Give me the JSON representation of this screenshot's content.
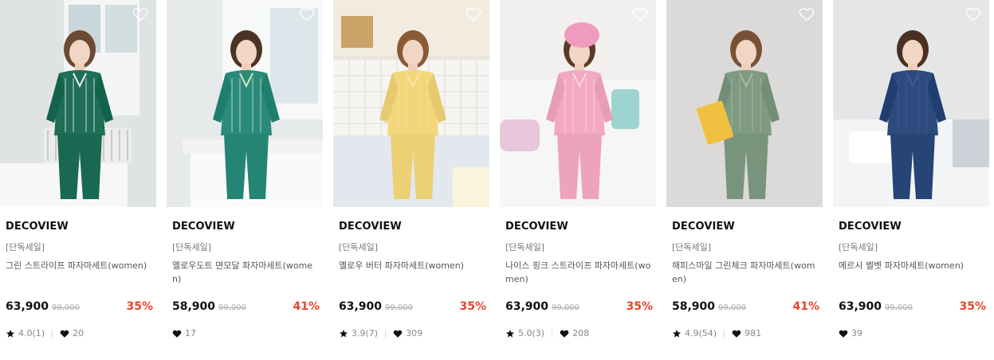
{
  "colors": {
    "discount": "#e8452c",
    "text": "#111111",
    "muted": "#888888"
  },
  "products": [
    {
      "brand": "DECOVIEW",
      "tag": "[단독세일]",
      "name": "그린 스트라이프 파자마세트(women)",
      "price": "63,900",
      "original_price": "99,000",
      "discount": "35%",
      "rating": "4.0(1)",
      "likes": "20",
      "image": {
        "bg": "#dfe3e2",
        "garment": "#1f6e57",
        "stripe": "#e9f1ec",
        "hair": "#6b4a33",
        "scene": "window-radiator"
      }
    },
    {
      "brand": "DECOVIEW",
      "tag": "[단독세일]",
      "name": "옐로우도트 면모달 파자마세트(women)",
      "price": "58,900",
      "original_price": "99,000",
      "discount": "41%",
      "rating": "",
      "likes": "17",
      "image": {
        "bg": "#e7eaea",
        "garment": "#2a8b7a",
        "stripe": "#d5e6c8",
        "hair": "#4b3424",
        "scene": "window-sill"
      }
    },
    {
      "brand": "DECOVIEW",
      "tag": "[단독세일]",
      "name": "옐로우 버터 파자마세트(women)",
      "price": "63,900",
      "original_price": "99,000",
      "discount": "35%",
      "rating": "3.9(7)",
      "likes": "309",
      "image": {
        "bg": "#e9e4dc",
        "garment": "#f3d67a",
        "stripe": "#f7e6a8",
        "hair": "#8a5a36",
        "scene": "kitchen"
      }
    },
    {
      "brand": "DECOVIEW",
      "tag": "[단독세일]",
      "name": "나이스 핑크 스트라이프 파자마세트(women)",
      "price": "63,900",
      "original_price": "99,000",
      "discount": "35%",
      "rating": "5.0(3)",
      "likes": "208",
      "image": {
        "bg": "#ecebe9",
        "garment": "#f3a9c4",
        "stripe": "#f9d4e2",
        "hair": "#5a3a25",
        "scene": "bed-towel"
      }
    },
    {
      "brand": "DECOVIEW",
      "tag": "[단독세일]",
      "name": "해피스마일 그린체크 파자마세트(women)",
      "price": "58,900",
      "original_price": "99,000",
      "discount": "41%",
      "rating": "4.9(54)",
      "likes": "981",
      "image": {
        "bg": "#dcdad8",
        "garment": "#7f9a83",
        "stripe": "#a7baa9",
        "hair": "#7a5136",
        "scene": "cereal"
      }
    },
    {
      "brand": "DECOVIEW",
      "tag": "[단독세일]",
      "name": "메르시 벨벳 파자마세트(women)",
      "price": "63,900",
      "original_price": "99,000",
      "discount": "35%",
      "rating": "",
      "likes": "39",
      "image": {
        "bg": "#e4e6e8",
        "garment": "#2c4a7c",
        "stripe": "#3c5d94",
        "hair": "#4a3020",
        "scene": "bed"
      }
    }
  ]
}
